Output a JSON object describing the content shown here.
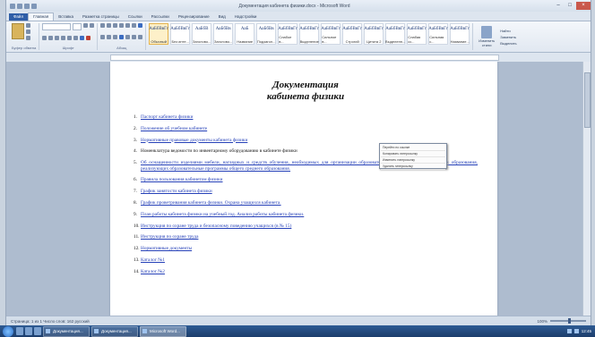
{
  "window": {
    "title": "Документация кабинета физики.docx - Microsoft Word"
  },
  "tabs": [
    "Файл",
    "Главная",
    "Вставка",
    "Разметка страницы",
    "Ссылки",
    "Рассылки",
    "Рецензирование",
    "Вид",
    "Надстройки"
  ],
  "ribbon": {
    "groups": [
      "Буфер обмена",
      "Шрифт",
      "Абзац",
      "Стили",
      "Редактирование"
    ],
    "styles": [
      {
        "sample": "АаБбВвГг",
        "name": "Обычный"
      },
      {
        "sample": "АаБбВвГг",
        "name": "Без инте..."
      },
      {
        "sample": "АаБбВ",
        "name": "Заголово..."
      },
      {
        "sample": "АаБбВв",
        "name": "Заголово..."
      },
      {
        "sample": "АаБ",
        "name": "Название"
      },
      {
        "sample": "АаБбВв",
        "name": "Подзагол..."
      },
      {
        "sample": "АаБбВвГг",
        "name": "Слабое в..."
      },
      {
        "sample": "АаБбВвГг",
        "name": "Выделение"
      },
      {
        "sample": "АаБбВвГг",
        "name": "Сильное в..."
      },
      {
        "sample": "АаБбВвГг",
        "name": "Строгий"
      },
      {
        "sample": "АаБбВвГг",
        "name": "Цитата 2"
      },
      {
        "sample": "АаБбВвГг",
        "name": "Выделенн..."
      },
      {
        "sample": "АаБбВвГг",
        "name": "Слабая сс..."
      },
      {
        "sample": "АаБбВвГг",
        "name": "Сильная с..."
      },
      {
        "sample": "АаБбВвГг",
        "name": "Название..."
      }
    ],
    "change_styles": "Изменить стили",
    "editing": [
      "Найти",
      "Заменить",
      "Выделить"
    ]
  },
  "document": {
    "title_line1": "Документация",
    "title_line2": "кабинета физики",
    "items": [
      {
        "num": "1.",
        "text": "Паспорт кабинета физики",
        "link": true
      },
      {
        "num": "2.",
        "text": "Положение об учебном кабинете",
        "link": true
      },
      {
        "num": "3.",
        "text": "Нормативные правовые документы кабинета физики",
        "link": true
      },
      {
        "num": "4.",
        "text": "Номенклатура ведомости по инвентарному оборудованию в кабинете физики",
        "link": false
      },
      {
        "num": "5.",
        "text": "Об оснащенности изделиями мебели, наглядных и средств обучения, необходимых для организации образовательного процесса в учреждениях образования, реализующих образовательные программы общего среднего образования.",
        "link": true
      },
      {
        "num": "6.",
        "text": "Правила пользования кабинетом физики",
        "link": true
      },
      {
        "num": "7.",
        "text": "График занятости кабинета физики",
        "link": true
      },
      {
        "num": "8.",
        "text": "График проветривания кабинета физики. Охрана учащихся кабинета.",
        "link": true
      },
      {
        "num": "9.",
        "text": "План работы кабинета физики на учебный год. Анализ работы кабинета физики.",
        "link": true
      },
      {
        "num": "10.",
        "text": "Инструкция по охране труда и безопасному поведению учащихся (в № 15)",
        "link": true
      },
      {
        "num": "11.",
        "text": "Инструкция по охране труда",
        "link": true
      },
      {
        "num": "12.",
        "text": "Нормативные документы",
        "link": true
      },
      {
        "num": "13.",
        "text": "Каталог №1",
        "link": true
      },
      {
        "num": "14.",
        "text": "Каталог №2",
        "link": true
      }
    ],
    "popup_lines": [
      "Перейти по ссылке",
      "Копировать гиперссылку",
      "Изменить гиперссылку",
      "Удалить гиперссылку"
    ]
  },
  "status": {
    "left": "Страница: 1 из 1   Число слов: 162   русский",
    "zoom": "100%"
  },
  "taskbar": {
    "tasks": [
      "Документация...",
      "Документация...",
      "Microsoft Word..."
    ],
    "time": "12:45"
  }
}
